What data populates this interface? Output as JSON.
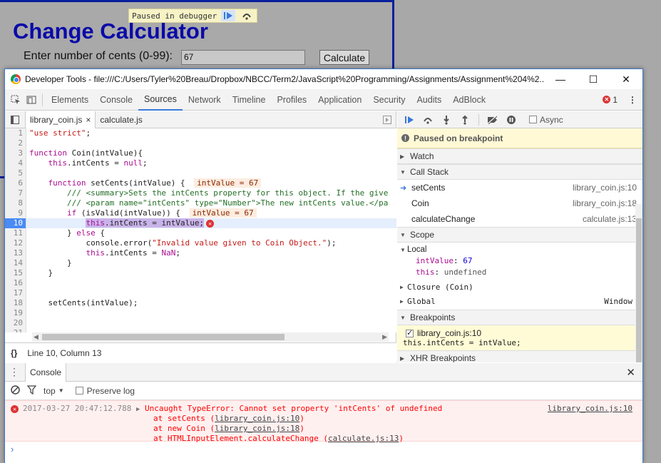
{
  "page": {
    "title": "Change Calculator",
    "cents_label": "Enter number of cents (0-99):",
    "cents_value": "67",
    "calculate_button": "Calculate",
    "paused_banner": "Paused in debugger"
  },
  "window": {
    "title": "Developer Tools - file:///C:/Users/Tyler%20Breau/Dropbox/NBCC/Term2/JavaScript%20Programming/Assignments/Assignment%204%2...",
    "minimize": "—",
    "maximize": "☐",
    "close": "✕"
  },
  "tabs": [
    "Elements",
    "Console",
    "Sources",
    "Network",
    "Timeline",
    "Profiles",
    "Application",
    "Security",
    "Audits",
    "AdBlock"
  ],
  "active_tab": "Sources",
  "error_count": "1",
  "file_tabs": [
    {
      "label": "library_coin.js",
      "close": "×"
    },
    {
      "label": "calculate.js"
    }
  ],
  "status_line": {
    "braces": "{}",
    "position": "Line 10, Column 13"
  },
  "code": {
    "breakpoint_line": 10,
    "inline_values": {
      "l6": "intValue = 67",
      "l9": "intValue = 67"
    }
  },
  "debugger": {
    "async_label": "Async",
    "paused_message": "Paused on breakpoint",
    "watch_label": "Watch",
    "call_stack_label": "Call Stack",
    "call_stack": [
      {
        "name": "setCents",
        "location": "library_coin.js:10"
      },
      {
        "name": "Coin",
        "location": "library_coin.js:18"
      },
      {
        "name": "calculateChange",
        "location": "calculate.js:13"
      }
    ],
    "scope_label": "Scope",
    "local_label": "Local",
    "local_vars": [
      {
        "name": "intValue",
        "value": "67"
      },
      {
        "name": "this",
        "value": "undefined"
      }
    ],
    "closure_label": "Closure (Coin)",
    "global_label": "Global",
    "global_value": "Window",
    "breakpoints_label": "Breakpoints",
    "breakpoint_file": "library_coin.js:10",
    "breakpoint_code": "this.intCents = intValue;",
    "xhr_label": "XHR Breakpoints"
  },
  "console": {
    "tab_label": "Console",
    "context": "top",
    "preserve_log": "Preserve log",
    "timestamp": "2017-03-27 20:47:12.788",
    "error_message": "Uncaught TypeError: Cannot set property 'intCents' of undefined",
    "error_source": "library_coin.js:10",
    "stack": [
      {
        "prefix": "at setCents (",
        "link": "library_coin.js:10",
        "suffix": ")"
      },
      {
        "prefix": "at new Coin (",
        "link": "library_coin.js:18",
        "suffix": ")"
      },
      {
        "prefix": "at HTMLInputElement.calculateChange (",
        "link": "calculate.js:13",
        "suffix": ")"
      }
    ],
    "prompt": "›"
  }
}
